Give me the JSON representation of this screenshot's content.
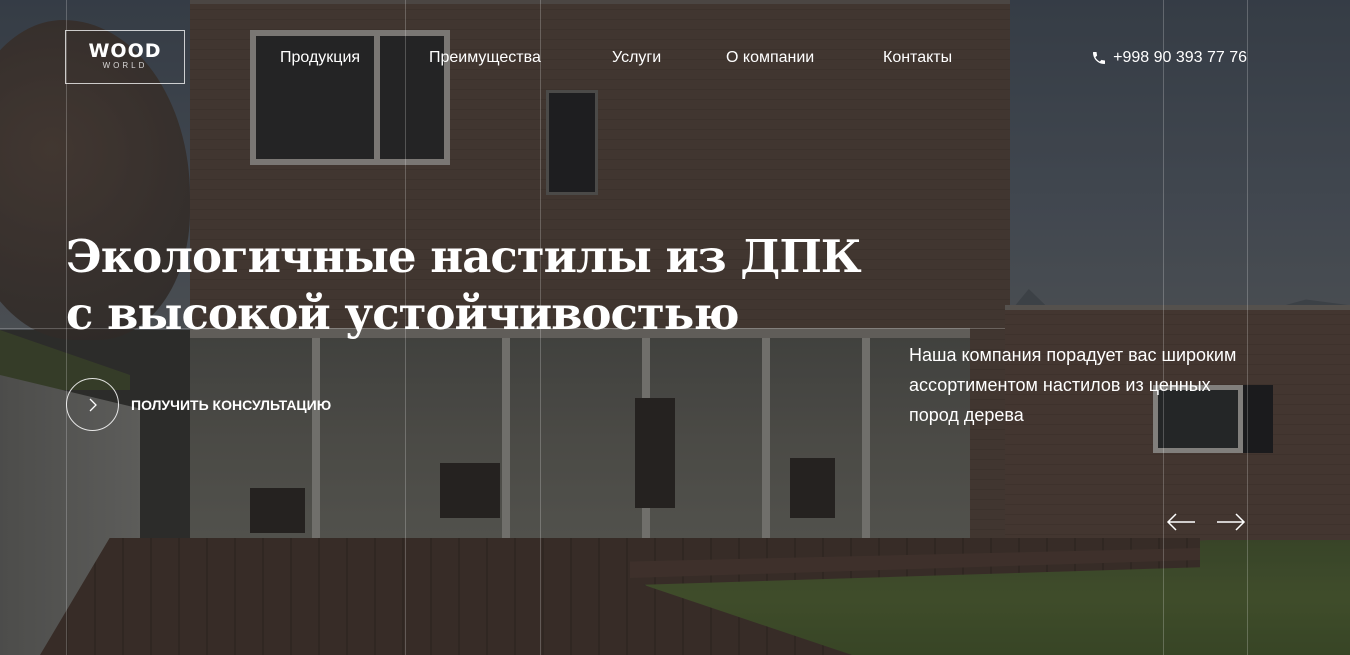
{
  "brand": {
    "logo_main": "WOOD",
    "logo_sub": "WORLD"
  },
  "nav": {
    "items": [
      {
        "label": "Продукция"
      },
      {
        "label": "Преимущества"
      },
      {
        "label": "Услуги"
      },
      {
        "label": "О компании"
      },
      {
        "label": "Контакты"
      }
    ]
  },
  "contact": {
    "phone": "+998 90 393 77 76",
    "icon": "phone-icon"
  },
  "hero": {
    "headline_line1": "Экологичные настилы из ДПК",
    "headline_line2": "с высокой устойчивостью",
    "cta_label": "ПОЛУЧИТЬ КОНСУЛЬТАЦИЮ",
    "cta_icon": "chevron-right-icon",
    "tagline": "Наша компания порадует вас широким ассортиментом настилов из ценных пород дерева"
  },
  "slider": {
    "prev_icon": "arrow-left-icon",
    "next_icon": "arrow-right-icon"
  },
  "colors": {
    "text": "#ffffff",
    "overlay": "#141416"
  }
}
